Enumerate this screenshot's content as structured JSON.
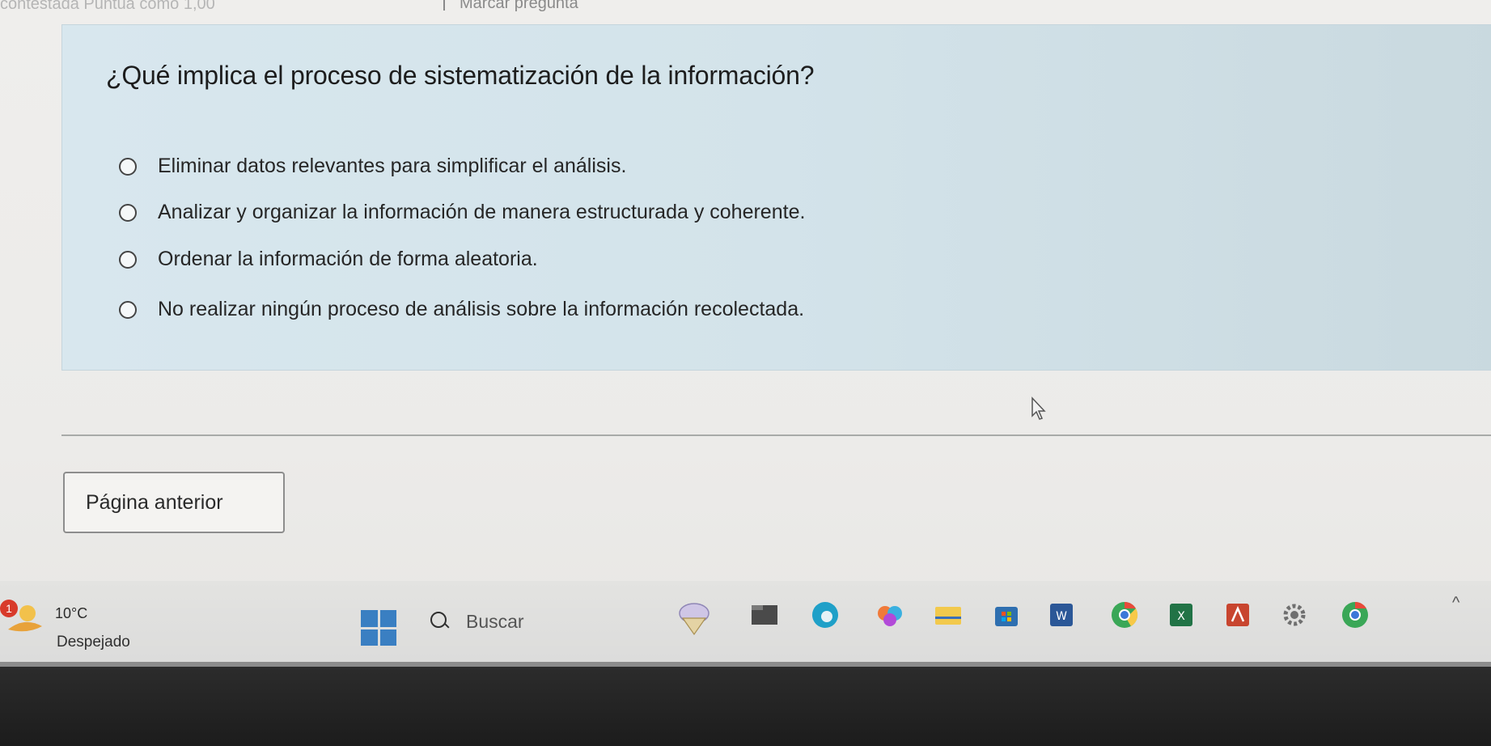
{
  "top_bar": {
    "faded_text": "contestada   Puntúa como 1,00",
    "flag_label": "Marcar pregunta"
  },
  "question": {
    "text": "¿Qué implica el proceso de sistematización de la información?",
    "options": [
      {
        "label": "Eliminar datos relevantes para simplificar el análisis."
      },
      {
        "label": "Analizar y organizar la información de manera estructurada y coherente."
      },
      {
        "label": "Ordenar la información de forma aleatoria."
      },
      {
        "label": "No realizar ningún proceso de análisis sobre la información recolectada."
      }
    ]
  },
  "navigation": {
    "prev_label": "Página anterior"
  },
  "taskbar": {
    "weather": {
      "badge": "1",
      "temp": "10°C",
      "desc": "Despejado"
    },
    "search_placeholder": "Buscar",
    "pinned_icons": [
      "ice-cream-icon",
      "file-explorer-icon",
      "edge-icon",
      "photos-icon",
      "folder-icon",
      "store-icon",
      "word-icon",
      "chrome-icon",
      "excel-icon",
      "acrobat-icon",
      "settings-icon",
      "chrome-alt-icon"
    ]
  }
}
